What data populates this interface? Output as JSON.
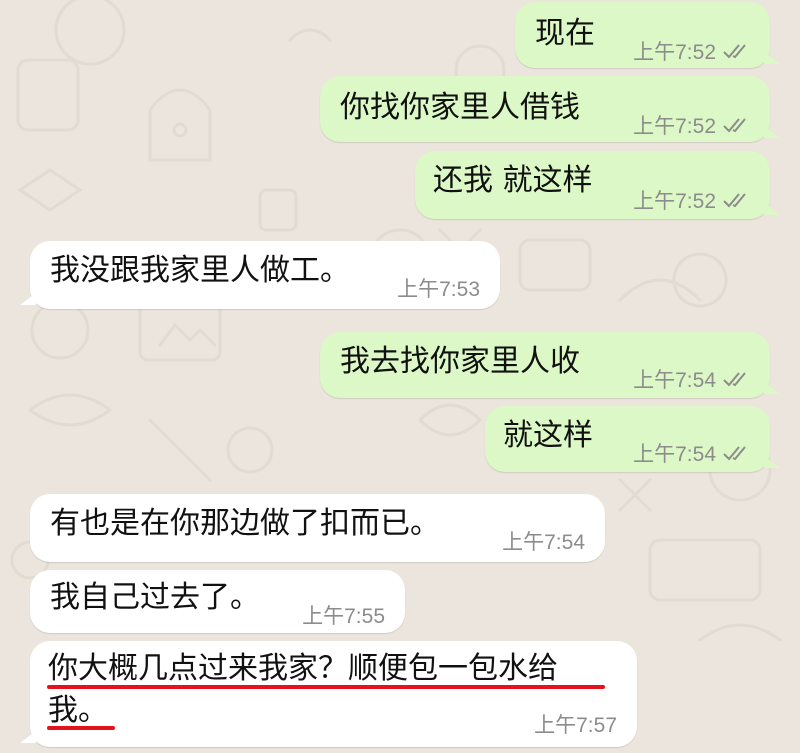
{
  "chat": {
    "messages": [
      {
        "direction": "outgoing",
        "text": "现在",
        "time": "上午7:52",
        "status": "read"
      },
      {
        "direction": "outgoing",
        "text": "你找你家里人借钱",
        "time": "上午7:52",
        "status": "read"
      },
      {
        "direction": "outgoing",
        "text": "还我 就这样",
        "time": "上午7:52",
        "status": "read"
      },
      {
        "direction": "incoming",
        "text": "我没跟我家里人做工。",
        "time": "上午7:53"
      },
      {
        "direction": "outgoing",
        "text": "我去找你家里人收",
        "time": "上午7:54",
        "status": "read"
      },
      {
        "direction": "outgoing",
        "text": "就这样",
        "time": "上午7:54",
        "status": "read"
      },
      {
        "direction": "incoming",
        "text": "有也是在你那边做了扣而已。",
        "time": "上午7:54"
      },
      {
        "direction": "incoming",
        "text": "我自己过去了。",
        "time": "上午7:55"
      },
      {
        "direction": "incoming",
        "text_line1": "你大概几点过来我家？顺便包一包水给",
        "text_line2": "我。",
        "time": "上午7:57",
        "highlighted": true
      }
    ]
  },
  "colors": {
    "wallpaper": "#ECE5DD",
    "outgoing_bubble": "#DCF8C6",
    "incoming_bubble": "#FFFFFF",
    "read_ticks": "#8c8c8c",
    "annotation_underline": "#E5121E"
  },
  "icons": {
    "status": "double-check-icon"
  }
}
